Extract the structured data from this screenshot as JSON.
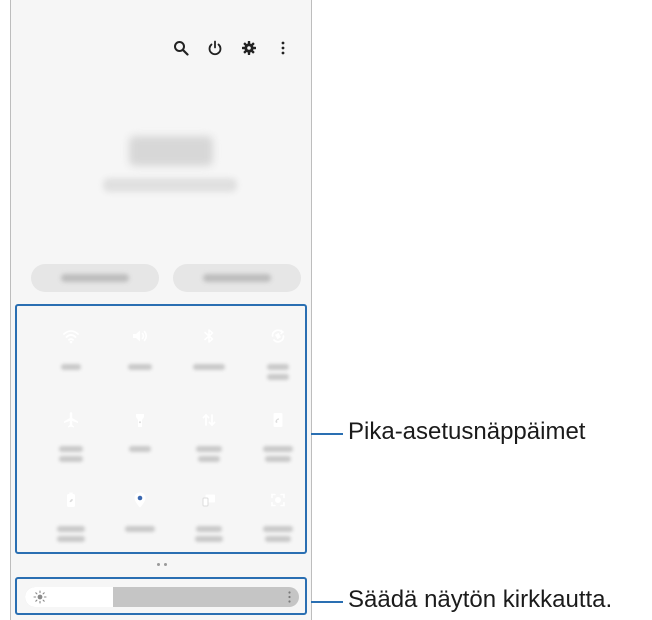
{
  "accent_color": "#3b68b0",
  "callout_color": "#2a6fb2",
  "header_icons": [
    {
      "name": "search-icon"
    },
    {
      "name": "power-icon"
    },
    {
      "name": "gear-icon"
    },
    {
      "name": "more-vertical-icon"
    }
  ],
  "quick_settings": [
    {
      "name": "wifi-icon",
      "active": true
    },
    {
      "name": "volume-icon",
      "active": true
    },
    {
      "name": "bluetooth-icon",
      "active": true
    },
    {
      "name": "auto-rotate-icon",
      "active": true
    },
    {
      "name": "airplane-icon",
      "active": false
    },
    {
      "name": "flashlight-icon",
      "active": false
    },
    {
      "name": "mobile-data-icon",
      "active": true
    },
    {
      "name": "hotspot-icon",
      "active": false
    },
    {
      "name": "power-saving-icon",
      "active": false
    },
    {
      "name": "location-icon",
      "active": true
    },
    {
      "name": "link-to-windows-icon",
      "active": false
    },
    {
      "name": "screen-recorder-icon",
      "active": false
    }
  ],
  "brightness": {
    "level": 0.32
  },
  "callouts": {
    "quick_settings": "Pika-asetusnäppäimet",
    "brightness": "Säädä näytön kirkkautta."
  }
}
